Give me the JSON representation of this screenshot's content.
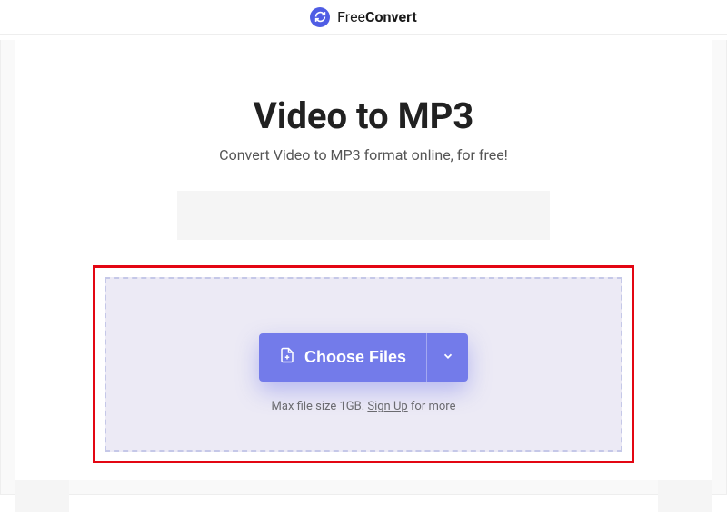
{
  "header": {
    "brand_prefix": "Free",
    "brand_suffix": "Convert"
  },
  "main": {
    "title": "Video to MP3",
    "subtitle": "Convert Video to MP3 format online, for free!"
  },
  "dropzone": {
    "choose_label": "Choose Files",
    "note_prefix": "Max file size 1GB. ",
    "signup_label": "Sign Up",
    "note_suffix": " for more"
  }
}
